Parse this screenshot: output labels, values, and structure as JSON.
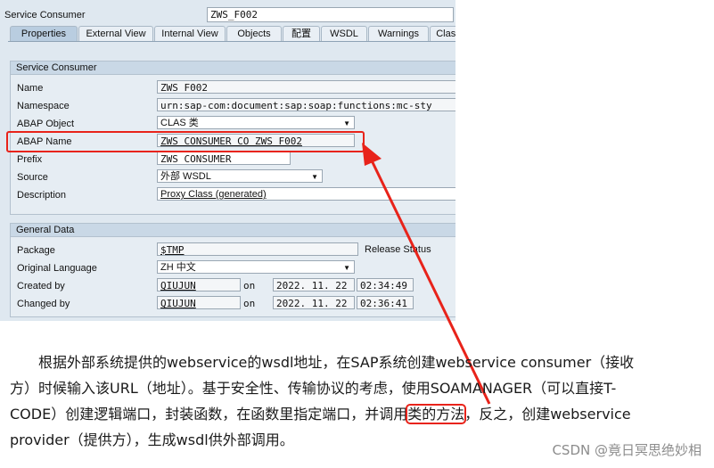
{
  "header": {
    "label": "Service Consumer",
    "value": "ZWS_F002"
  },
  "tabs": [
    "Properties",
    "External View",
    "Internal View",
    "Objects",
    "配置",
    "WSDL",
    "Warnings",
    "Class"
  ],
  "service_consumer_group": {
    "title": "Service Consumer",
    "name": {
      "label": "Name",
      "value": "ZWS_F002"
    },
    "namespace": {
      "label": "Namespace",
      "value": "urn:sap-com:document:sap:soap:functions:mc-sty"
    },
    "abap_object": {
      "label": "ABAP Object",
      "value": "CLAS 类"
    },
    "abap_name": {
      "label": "ABAP Name",
      "value": "ZWS_CONSUMER_CO_ZWS_F002"
    },
    "prefix": {
      "label": "Prefix",
      "value": "ZWS_CONSUMER_"
    },
    "source": {
      "label": "Source",
      "value": "外部 WSDL"
    },
    "description": {
      "label": "Description",
      "value": "Proxy Class (generated)"
    }
  },
  "general_data_group": {
    "title": "General Data",
    "package": {
      "label": "Package",
      "value": "$TMP",
      "status_label": "Release Status"
    },
    "original_language": {
      "label": "Original Language",
      "value": "ZH 中文"
    },
    "created_by": {
      "label": "Created by",
      "user": "QIUJUN",
      "on": "on",
      "date": "2022. 11. 22",
      "time": "02:34:49"
    },
    "changed_by": {
      "label": "Changed by",
      "user": "QIUJUN",
      "on": "on",
      "date": "2022. 11. 22",
      "time": "02:36:41"
    }
  },
  "article": {
    "line1": "根据外部系统提供的webservice的wsdl地址，在SAP系统创建webservice consumer（接收",
    "line2": "方）时候输入该URL（地址）。基于安全性、传输协议的考虑，使用SOAMANAGER（可以直接T-",
    "line3_before": "CODE）创建逻辑端口，封装函数，在函数里指定端口，并调用",
    "line3_highlight": "类的方法",
    "line3_after": "，反之，创建webservice",
    "line4": "provider（提供方），生成wsdl供外部调用。"
  },
  "watermark": "CSDN @竟日冥思绝妙相",
  "colors": {
    "highlight_red": "#e8231a",
    "sap_bg": "#dfe8f0"
  }
}
